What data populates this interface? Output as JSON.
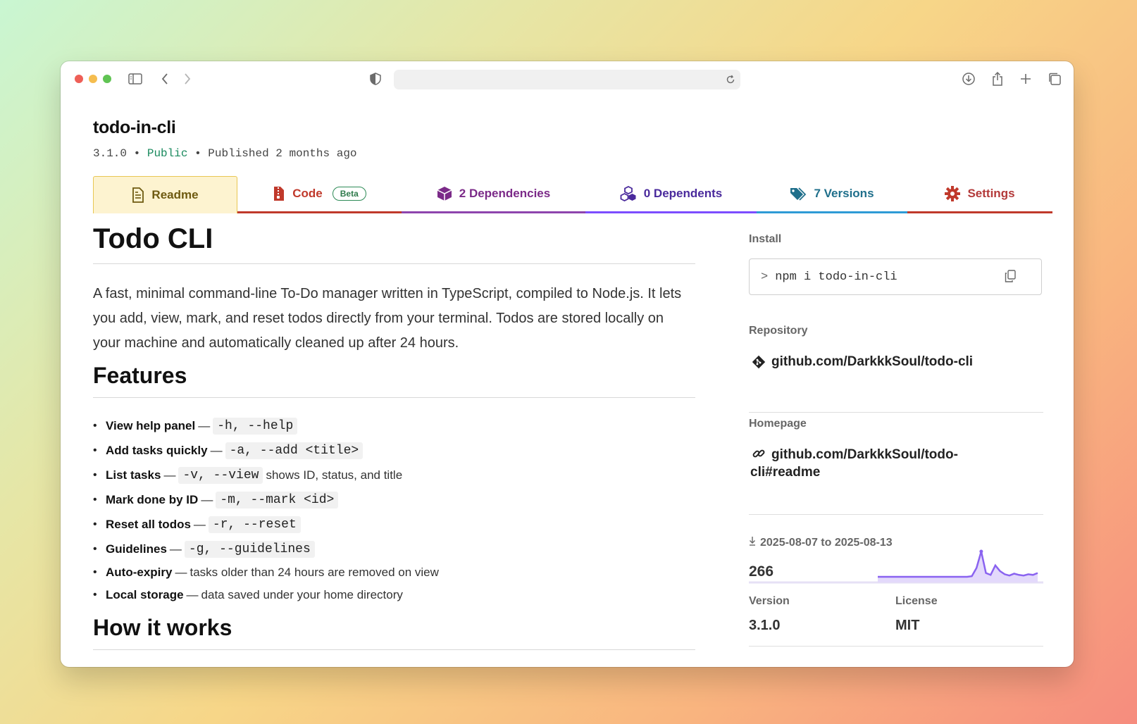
{
  "package": {
    "name": "todo-in-cli",
    "version": "3.1.0",
    "separator": "•",
    "visibility": "Public",
    "published": "Published 2 months ago"
  },
  "tabs": [
    {
      "label": "Readme",
      "color": "#6e5a10",
      "line": "#e8c653",
      "icon": "document-icon"
    },
    {
      "label": "Code",
      "badge": "Beta",
      "color": "#c0392b",
      "line": "#c0392b",
      "icon": "code-file-icon"
    },
    {
      "label": "2 Dependencies",
      "color": "#7b2a88",
      "line": "#8e44ad",
      "icon": "package-icon"
    },
    {
      "label": "0 Dependents",
      "color": "#4a2a9c",
      "line": "#7c4dff",
      "icon": "packages-icon"
    },
    {
      "label": "7 Versions",
      "color": "#1f6f8b",
      "line": "#2e9bd6",
      "icon": "tags-icon"
    },
    {
      "label": "Settings",
      "color": "#b33a3a",
      "line": "#c0392b",
      "icon": "gear-icon"
    }
  ],
  "readme": {
    "title": "Todo CLI",
    "intro": "A fast, minimal command-line To-Do manager written in TypeScript, compiled to Node.js. It lets you add, view, mark, and reset todos directly from your terminal. Todos are stored locally on your machine and automatically cleaned up after 24 hours.",
    "features_heading": "Features",
    "features": [
      {
        "name": "View help panel",
        "dash": "—",
        "code": "-h, --help",
        "text": ""
      },
      {
        "name": "Add tasks quickly",
        "dash": "—",
        "code": "-a, --add <title>",
        "text": ""
      },
      {
        "name": "List tasks",
        "dash": "—",
        "code": "-v, --view",
        "text": "shows ID, status, and title"
      },
      {
        "name": "Mark done by ID",
        "dash": "—",
        "code": "-m, --mark <id>",
        "text": ""
      },
      {
        "name": "Reset all todos",
        "dash": "—",
        "code": "-r, --reset",
        "text": ""
      },
      {
        "name": "Guidelines",
        "dash": "—",
        "code": "-g, --guidelines",
        "text": ""
      },
      {
        "name": "Auto-expiry",
        "dash": "—",
        "code": "",
        "text": "tasks older than 24 hours are removed on view"
      },
      {
        "name": "Local storage",
        "dash": "—",
        "code": "",
        "text": "data saved under your home directory"
      }
    ],
    "how_heading": "How it works"
  },
  "sidebar": {
    "install_label": "Install",
    "install_prompt": ">",
    "install_cmd": "npm i todo-in-cli",
    "repository_label": "Repository",
    "repository": "github.com/DarkkkSoul/todo-cli",
    "homepage_label": "Homepage",
    "homepage_line1": "github.com/DarkkkSoul/todo-",
    "homepage_line2": "cli#readme",
    "downloads_range": "2025-08-07 to 2025-08-13",
    "downloads": "266",
    "downloads_series": [
      0,
      0,
      0,
      0,
      0,
      0,
      0,
      0,
      0,
      0,
      0,
      0,
      0,
      0,
      0,
      0,
      0,
      0,
      0,
      0,
      1,
      14,
      40,
      6,
      3,
      18,
      9,
      4,
      2,
      5,
      3,
      2,
      4,
      3,
      6
    ],
    "version_label": "Version",
    "version": "3.1.0",
    "license_label": "License",
    "license": "MIT"
  }
}
